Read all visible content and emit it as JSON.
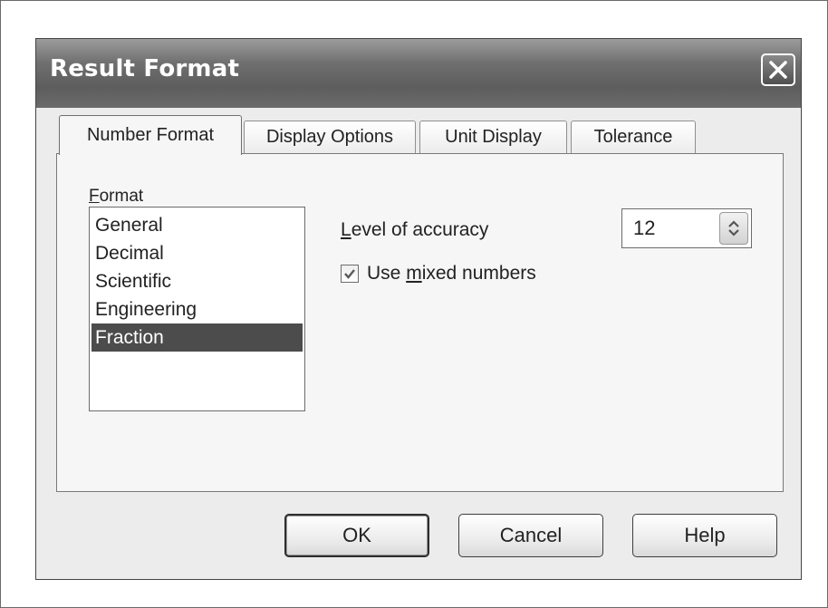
{
  "window": {
    "title": "Result Format",
    "close_icon": "close-icon"
  },
  "tabs": [
    {
      "label": "Number Format",
      "active": true
    },
    {
      "label": "Display Options",
      "active": false
    },
    {
      "label": "Unit Display",
      "active": false
    },
    {
      "label": "Tolerance",
      "active": false
    }
  ],
  "format": {
    "label": "Format",
    "label_mnemonic": "F",
    "label_rest": "ormat",
    "items": [
      "General",
      "Decimal",
      "Scientific",
      "Engineering",
      "Fraction"
    ],
    "selected": "Fraction"
  },
  "accuracy": {
    "label": "Level of accuracy",
    "label_mnemonic": "L",
    "label_rest": "evel of accuracy",
    "value": "12"
  },
  "mixed_numbers": {
    "label": "Use mixed numbers",
    "label_before": "Use ",
    "label_mnemonic": "m",
    "label_after": "ixed numbers",
    "checked": true
  },
  "buttons": {
    "ok": "OK",
    "cancel": "Cancel",
    "help": "Help"
  },
  "colors": {
    "titlebar": "#6f6f6f",
    "selection": "#4c4c4c",
    "dialog_face": "#ececec"
  }
}
